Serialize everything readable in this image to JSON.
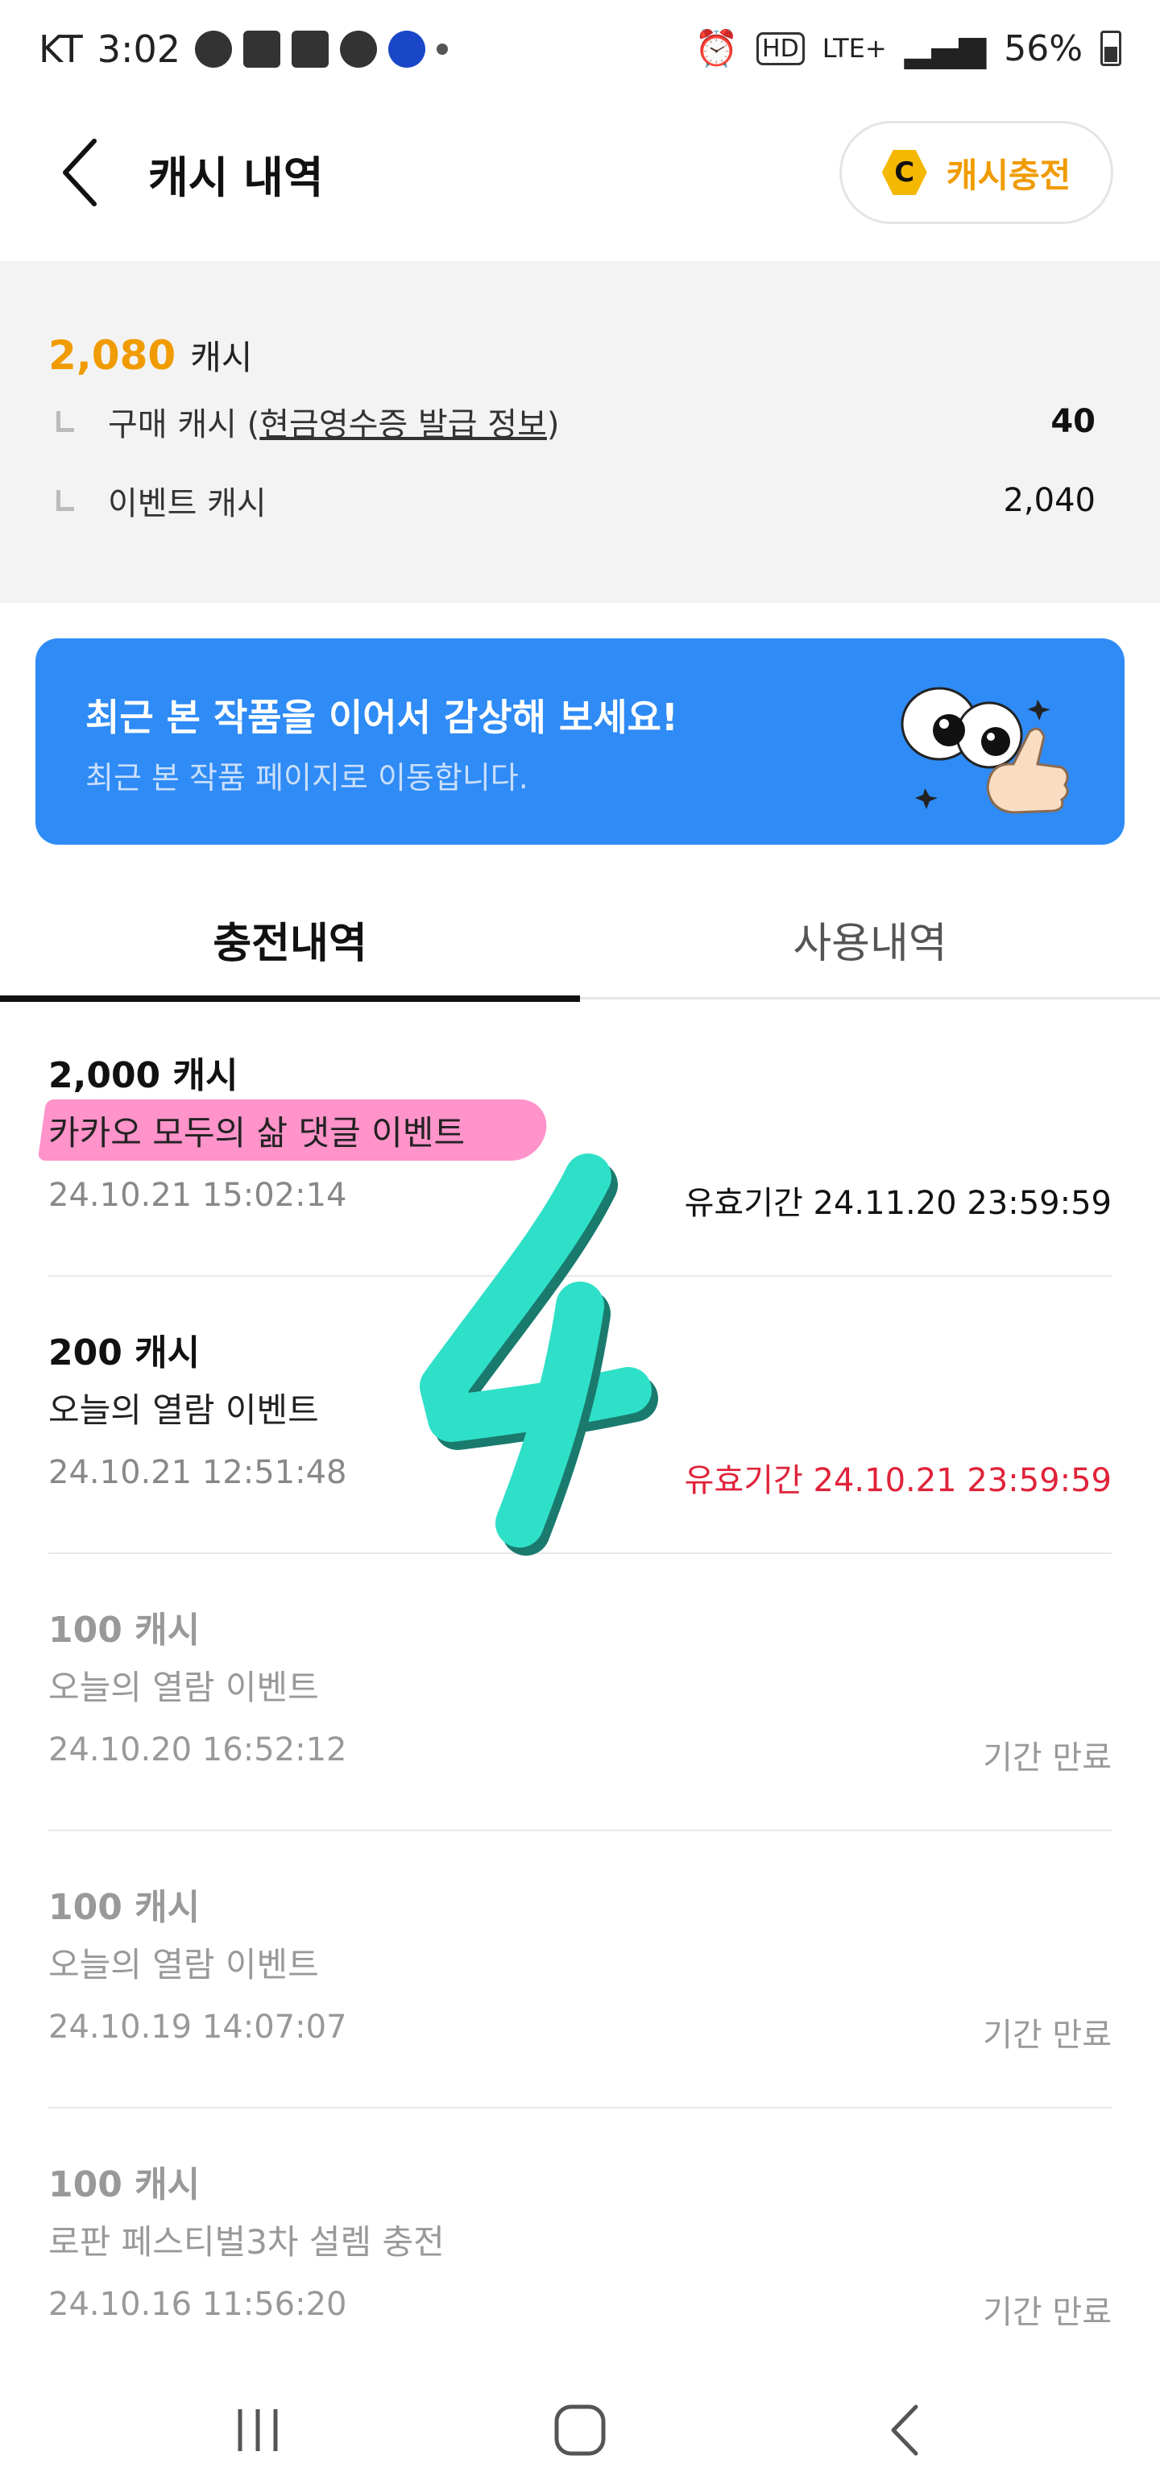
{
  "status_bar": {
    "carrier": "KT",
    "time": "3:02",
    "network": "LTE+",
    "hd": "HD",
    "battery": "56%"
  },
  "header": {
    "title": "캐시 내역",
    "charge_label": "캐시충전",
    "coin_letter": "C"
  },
  "balance": {
    "total": "2,080",
    "total_unit": "캐시",
    "purchase_label_prefix": "구매 캐시 (",
    "purchase_link": "현금영수증 발급 정보",
    "purchase_label_suffix": ")",
    "purchase_value": "40",
    "event_label": "이벤트 캐시",
    "event_value": "2,040"
  },
  "banner": {
    "title": "최근 본 작품을 이어서 감상해 보세요!",
    "subtitle": "최근 본 작품 페이지로 이동합니다."
  },
  "tabs": [
    {
      "label": "충전내역",
      "active": true
    },
    {
      "label": "사용내역",
      "active": false
    }
  ],
  "items": [
    {
      "amount": "2,000 캐시",
      "name": "카카오 모두의 삶 댓글 이벤트",
      "date": "24.10.21 15:02:14",
      "status": "유효기간 24.11.20 23:59:59"
    },
    {
      "amount": "200 캐시",
      "name": "오늘의 열람 이벤트",
      "date": "24.10.21 12:51:48",
      "status": "유효기간 24.10.21 23:59:59"
    },
    {
      "amount": "100 캐시",
      "name": "오늘의 열람 이벤트",
      "date": "24.10.20 16:52:12",
      "status": "기간 만료"
    },
    {
      "amount": "100 캐시",
      "name": "오늘의 열람 이벤트",
      "date": "24.10.19 14:07:07",
      "status": "기간 만료"
    },
    {
      "amount": "100 캐시",
      "name": "로판 페스티벌3차 설렘 충전",
      "date": "24.10.16 11:56:20",
      "status": "기간 만료"
    }
  ],
  "colors": {
    "accent": "#f09b00",
    "banner": "#2f8bf5",
    "warning": "#e0233a",
    "highlight": "#ff6fb8",
    "sticker": "#2fe0c8"
  },
  "icons": [
    "back-arrow-icon",
    "coin-icon",
    "eyes-thumbs-up-icon",
    "recent-apps-icon",
    "home-icon",
    "nav-back-icon"
  ]
}
